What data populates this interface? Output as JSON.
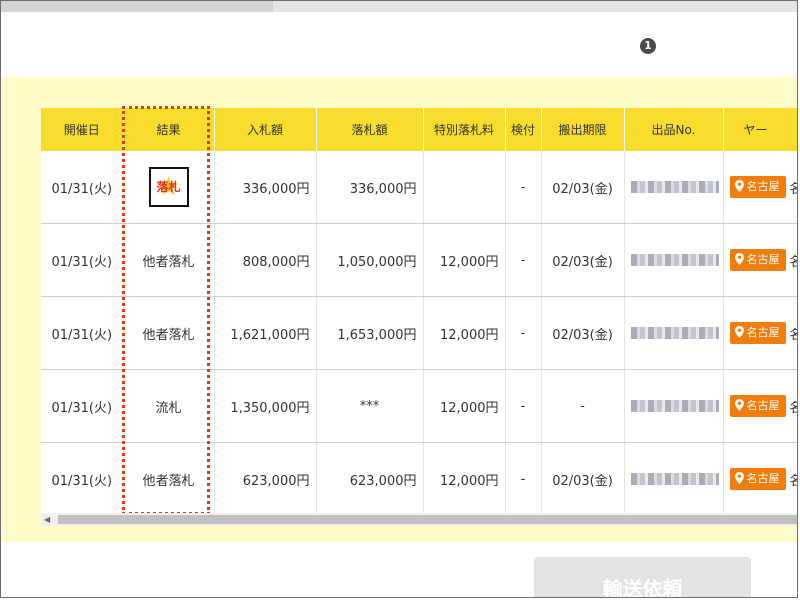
{
  "info_badge": "1",
  "table": {
    "headers": {
      "date": "開催日",
      "result": "結果",
      "bid": "入札額",
      "hammer": "落札額",
      "special_fee": "特別落札料",
      "inspection": "検付",
      "removal_deadline": "搬出期限",
      "lot_no": "出品No.",
      "yard": "ヤー"
    },
    "rows": [
      {
        "date": "01/31(火)",
        "result": "落札",
        "bid": "336,000円",
        "hammer": "336,000円",
        "special_fee": "",
        "inspection": "-",
        "removal_deadline": "02/03(金)",
        "yard_tag": "名古屋",
        "yard_text": "名"
      },
      {
        "date": "01/31(火)",
        "result": "他者落札",
        "bid": "808,000円",
        "hammer": "1,050,000円",
        "special_fee": "12,000円",
        "inspection": "-",
        "removal_deadline": "02/03(金)",
        "yard_tag": "名古屋",
        "yard_text": "名"
      },
      {
        "date": "01/31(火)",
        "result": "他者落札",
        "bid": "1,621,000円",
        "hammer": "1,653,000円",
        "special_fee": "12,000円",
        "inspection": "-",
        "removal_deadline": "02/03(金)",
        "yard_tag": "名古屋",
        "yard_text": "名"
      },
      {
        "date": "01/31(火)",
        "result": "流札",
        "bid": "1,350,000円",
        "hammer": "***",
        "special_fee": "12,000円",
        "inspection": "-",
        "removal_deadline": "-",
        "yard_tag": "名古屋",
        "yard_text": "名"
      },
      {
        "date": "01/31(火)",
        "result": "他者落札",
        "bid": "623,000円",
        "hammer": "623,000円",
        "special_fee": "12,000円",
        "inspection": "-",
        "removal_deadline": "02/03(金)",
        "yard_tag": "名古屋",
        "yard_text": "名"
      }
    ]
  },
  "transport_button": {
    "label": "輸送依頼"
  },
  "colors": {
    "header_bg": "#f8dd2c",
    "band_bg": "#fffcc9",
    "yard_tag_bg": "#f07d0c",
    "highlight_border": "#e33a12",
    "award_text": "#e8331a",
    "award_star": "#f7c81e"
  },
  "icons": {
    "info": "info-badge-icon",
    "pin": "map-pin-icon",
    "award": "star-icon",
    "scroll_left": "scroll-left-arrow-icon"
  }
}
